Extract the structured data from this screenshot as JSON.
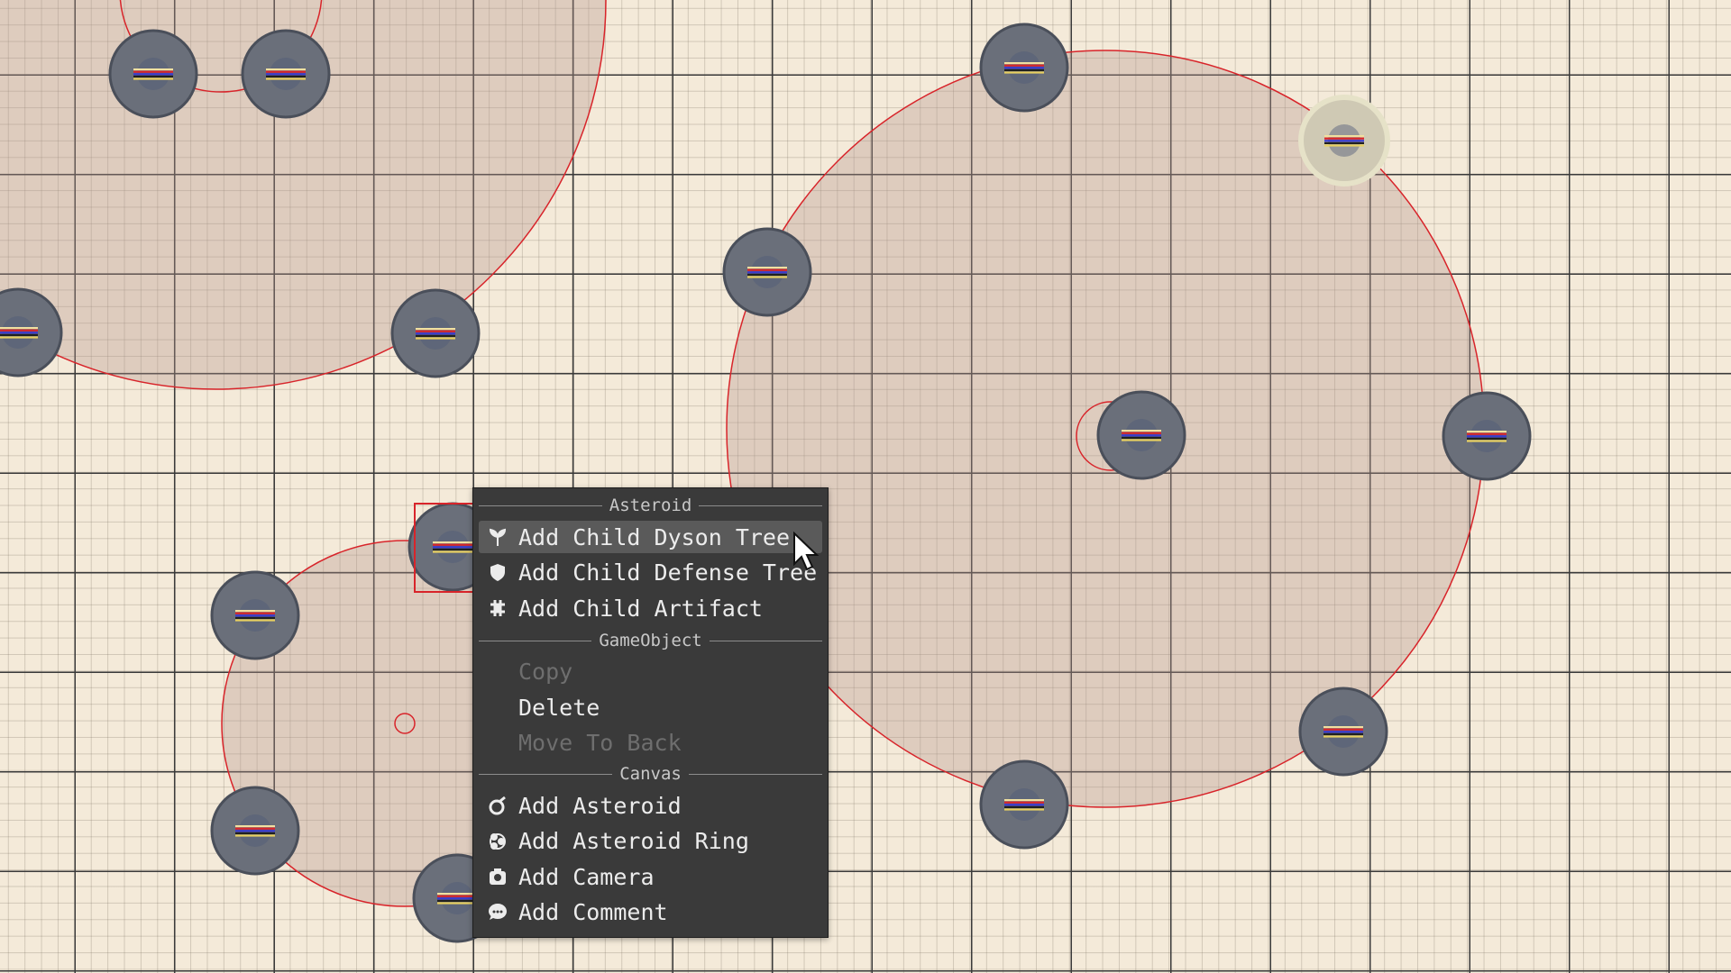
{
  "context_menu": {
    "sections": [
      {
        "title": "Asteroid",
        "items": [
          {
            "label": "Add Child Dyson Tree",
            "icon": "tree-icon",
            "enabled": true,
            "highlighted": true
          },
          {
            "label": "Add Child Defense Tree",
            "icon": "shield-icon",
            "enabled": true
          },
          {
            "label": "Add Child Artifact",
            "icon": "artifact-icon",
            "enabled": true
          }
        ]
      },
      {
        "title": "GameObject",
        "items": [
          {
            "label": "Copy",
            "enabled": false
          },
          {
            "label": "Delete",
            "enabled": true
          },
          {
            "label": "Move To Back",
            "enabled": false
          }
        ]
      },
      {
        "title": "Canvas",
        "items": [
          {
            "label": "Add Asteroid",
            "icon": "asteroid-icon",
            "enabled": true
          },
          {
            "label": "Add Asteroid Ring",
            "icon": "asteroid-ring-icon",
            "enabled": true
          },
          {
            "label": "Add Camera",
            "icon": "camera-icon",
            "enabled": true
          },
          {
            "label": "Add Comment",
            "icon": "comment-icon",
            "enabled": true
          }
        ]
      }
    ]
  },
  "colors": {
    "canvas_bg": "#f4ead9",
    "ring_line": "#d8242a",
    "asteroid_fill": "#6a6f7a",
    "menu_bg": "#3a3a3a",
    "menu_highlight": "#5a5a5a"
  }
}
